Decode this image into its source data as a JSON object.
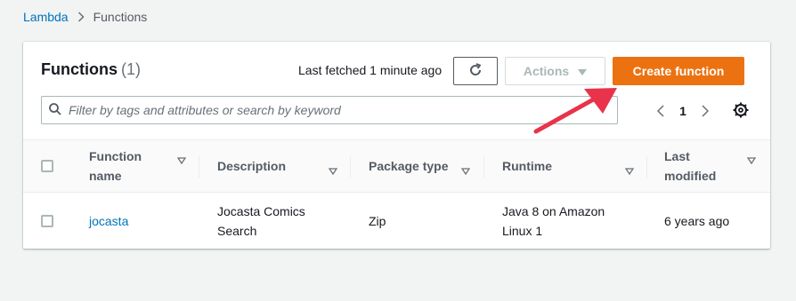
{
  "breadcrumb": {
    "root": "Lambda",
    "current": "Functions"
  },
  "header": {
    "title": "Functions",
    "count": "(1)",
    "last_fetched": "Last fetched 1 minute ago",
    "actions_label": "Actions",
    "create_label": "Create function"
  },
  "search": {
    "placeholder": "Filter by tags and attributes or search by keyword"
  },
  "pagination": {
    "current_page": "1"
  },
  "table": {
    "columns": [
      {
        "label": "Function name"
      },
      {
        "label": "Description"
      },
      {
        "label": "Package type"
      },
      {
        "label": "Runtime"
      },
      {
        "label": "Last modified"
      }
    ],
    "rows": [
      {
        "function_name": "jocasta",
        "description": "Jocasta Comics Search",
        "package_type": "Zip",
        "runtime": "Java 8 on Amazon Linux 1",
        "last_modified": "6 years ago"
      }
    ]
  },
  "colors": {
    "accent": "#ec7211",
    "link": "#0073bb",
    "annotation_arrow": "#e8334a"
  },
  "icons": [
    "chevron-right-icon",
    "refresh-icon",
    "caret-down-icon",
    "search-icon",
    "chevron-left-icon",
    "gear-icon",
    "sort-caret-icon",
    "annotation-arrow-icon"
  ]
}
